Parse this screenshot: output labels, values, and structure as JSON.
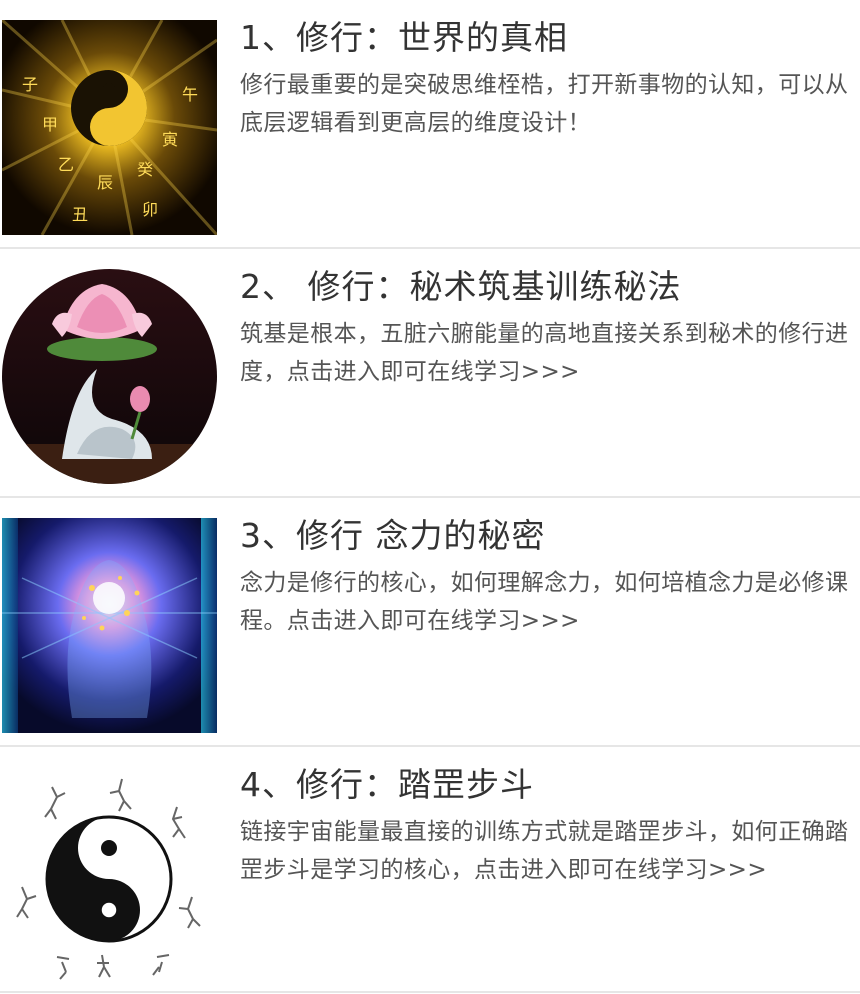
{
  "articles": [
    {
      "title": "1、修行：世界的真相",
      "description": "修行最重要的是突破思维桎梏，打开新事物的认知，可以从底层逻辑看到更高层的维度设计！",
      "image": "golden-yin-yang-zodiac-wheel"
    },
    {
      "title": "2、 修行：秘术筑基训练秘法",
      "description": "筑基是根本，五脏六腑能量的高地直接关系到秘术的修行进度，点击进入即可在线学习>>>",
      "image": "lotus-incense-burner"
    },
    {
      "title": "3、修行 念力的秘密",
      "description": "念力是修行的核心，如何理解念力，如何培植念力是必修课程。点击进入即可在线学习>>>",
      "image": "glowing-cosmic-head"
    },
    {
      "title": "4、修行：踏罡步斗",
      "description": "链接宇宙能量最直接的训练方式就是踏罡步斗，如何正确踏罡步斗是学习的核心，点击进入即可在线学习>>>",
      "image": "yin-yang-with-martial-artists"
    }
  ]
}
